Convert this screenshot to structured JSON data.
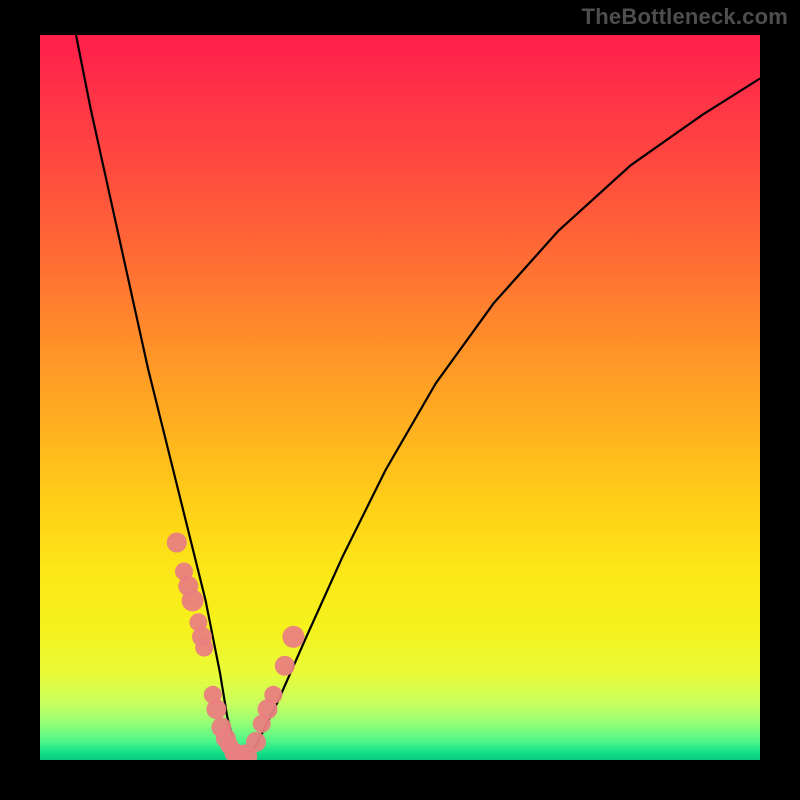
{
  "watermark": "TheBottleneck.com",
  "chart_data": {
    "type": "line",
    "title": "",
    "xlabel": "",
    "ylabel": "",
    "xlim": [
      0,
      100
    ],
    "ylim": [
      0,
      100
    ],
    "grid": false,
    "series": [
      {
        "name": "bottleneck-curve",
        "x": [
          5,
          7,
          9,
          11,
          13,
          15,
          17,
          19,
          21,
          23,
          24,
          25,
          26,
          27,
          28,
          30,
          33,
          37,
          42,
          48,
          55,
          63,
          72,
          82,
          92,
          100
        ],
        "values": [
          100,
          90,
          81,
          72,
          63,
          54,
          46,
          38,
          30,
          22,
          17,
          12,
          6,
          2,
          0,
          2,
          8,
          17,
          28,
          40,
          52,
          63,
          73,
          82,
          89,
          94
        ]
      }
    ],
    "scatter_points": {
      "name": "sample-points",
      "x": [
        19,
        20,
        20.6,
        21.2,
        22,
        22.5,
        22.8,
        24,
        24.5,
        25.2,
        25.8,
        26.3,
        27,
        27.7,
        28.5,
        30,
        30.8,
        31.6,
        32.4,
        34,
        35.2
      ],
      "values": [
        30,
        26,
        24,
        22,
        19,
        17,
        15.5,
        9,
        7,
        4.5,
        3,
        2,
        1,
        0.5,
        0.5,
        2.5,
        5,
        7,
        9,
        13,
        17
      ],
      "r": [
        10,
        9,
        10,
        11,
        9,
        10,
        9,
        9,
        10,
        10,
        10,
        9,
        10,
        11,
        12,
        10,
        9,
        10,
        9,
        10,
        11
      ]
    },
    "gradient_stops": [
      {
        "pos": 0,
        "color": "#ff1f4b"
      },
      {
        "pos": 17,
        "color": "#ff4740"
      },
      {
        "pos": 42,
        "color": "#ff8e2a"
      },
      {
        "pos": 66,
        "color": "#ffd317"
      },
      {
        "pos": 82,
        "color": "#f5f21d"
      },
      {
        "pos": 95,
        "color": "#93ff77"
      },
      {
        "pos": 100,
        "color": "#08c97e"
      }
    ]
  }
}
